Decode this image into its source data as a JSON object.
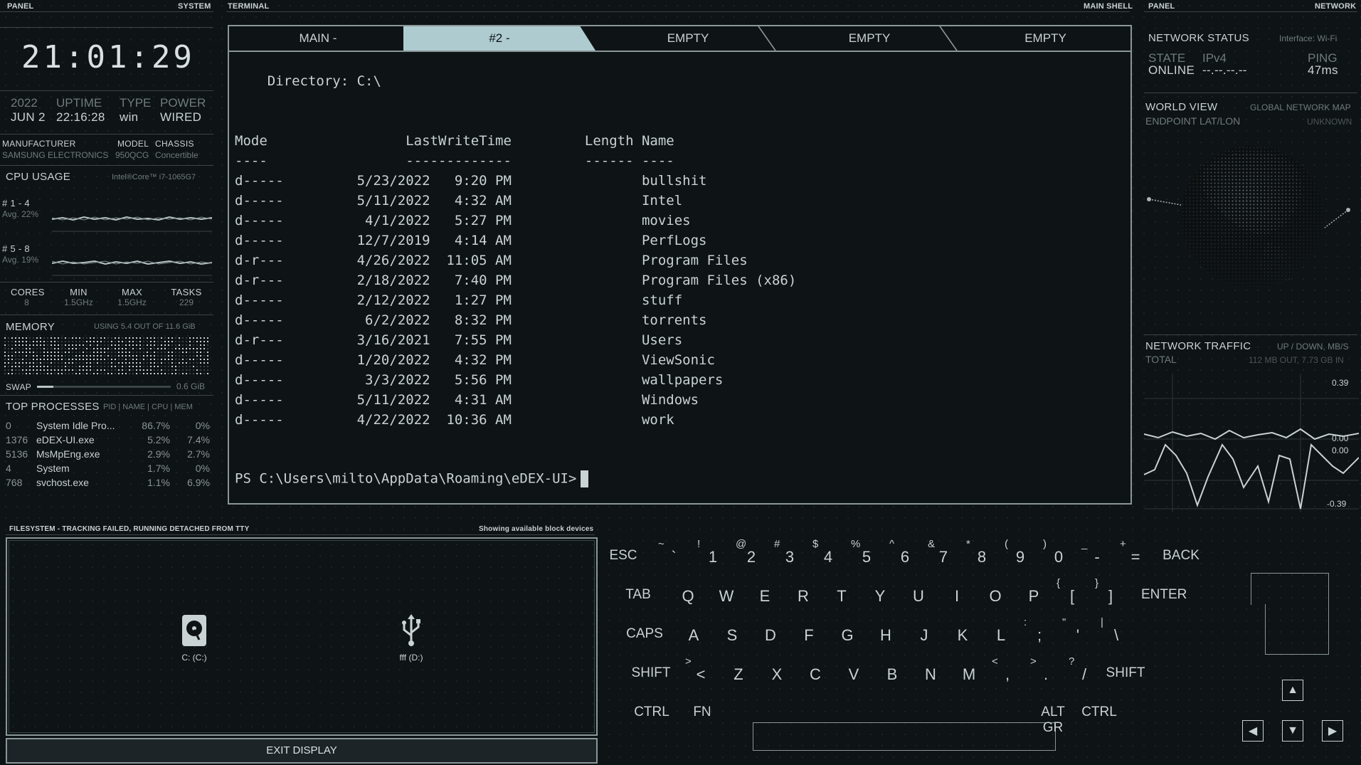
{
  "left_panel": {
    "header": {
      "left": "PANEL",
      "right": "SYSTEM"
    },
    "clock": "21:01:29",
    "sysinfo": [
      {
        "label": "2022",
        "value": "JUN 2"
      },
      {
        "label": "UPTIME",
        "value": "22:16:28"
      },
      {
        "label": "TYPE",
        "value": "win"
      },
      {
        "label": "POWER",
        "value": "WIRED"
      }
    ],
    "hw": {
      "manufacturer_label": "MANUFACTURER",
      "manufacturer": "SAMSUNG ELECTRONICS",
      "model_label": "MODEL",
      "model": "950QCG",
      "chassis_label": "CHASSIS",
      "chassis": "Concertible"
    },
    "cpu": {
      "title": "CPU USAGE",
      "model": "Intel®Core™ i7-1065G7",
      "group1": "# 1 - 4",
      "group1_avg": "Avg. 22%",
      "group2": "# 5 - 8",
      "group2_avg": "Avg. 19%",
      "stats": [
        {
          "label": "CORES",
          "value": "8"
        },
        {
          "label": "MIN",
          "value": "1.5GHz"
        },
        {
          "label": "MAX",
          "value": "1.5GHz"
        },
        {
          "label": "TASKS",
          "value": "229"
        }
      ]
    },
    "memory": {
      "title": "MEMORY",
      "usage": "USING 5.4 OUT OF 11.6 GiB",
      "swap_label": "SWAP",
      "swap_value": "0.6 GiB",
      "swap_fraction": 0.12
    },
    "processes": {
      "title": "TOP PROCESSES",
      "columns": "PID | NAME | CPU | MEM",
      "rows": [
        {
          "pid": "0",
          "name": "System Idle Pro...",
          "cpu": "86.7%",
          "mem": "0%"
        },
        {
          "pid": "1376",
          "name": "eDEX-UI.exe",
          "cpu": "5.2%",
          "mem": "7.4%"
        },
        {
          "pid": "5136",
          "name": "MsMpEng.exe",
          "cpu": "2.9%",
          "mem": "2.7%"
        },
        {
          "pid": "4",
          "name": "System",
          "cpu": "1.7%",
          "mem": "0%"
        },
        {
          "pid": "768",
          "name": "svchost.exe",
          "cpu": "1.1%",
          "mem": "6.9%"
        }
      ]
    }
  },
  "terminal": {
    "header": {
      "left": "TERMINAL",
      "right": "MAIN SHELL"
    },
    "tabs": [
      "MAIN -",
      "#2 -",
      "EMPTY",
      "EMPTY",
      "EMPTY"
    ],
    "directory_line": "    Directory: C:\\",
    "col_header": "Mode                 LastWriteTime         Length Name",
    "col_rule": "----                 -------------         ------ ----",
    "rows": [
      "d-----         5/23/2022   9:20 PM                bullshit",
      "d-----         5/11/2022   4:32 AM                Intel",
      "d-----          4/1/2022   5:27 PM                movies",
      "d-----         12/7/2019   4:14 AM                PerfLogs",
      "d-r---         4/26/2022  11:05 AM                Program Files",
      "d-r---         2/18/2022   7:40 PM                Program Files (x86)",
      "d-----         2/12/2022   1:27 PM                stuff",
      "d-----          6/2/2022   8:32 PM                torrents",
      "d-r---         3/16/2021   7:55 PM                Users",
      "d-----         1/20/2022   4:32 PM                ViewSonic",
      "d-----          3/3/2022   5:56 PM                wallpapers",
      "d-----         5/11/2022   4:31 AM                Windows",
      "d-----         4/22/2022  10:36 AM                work"
    ],
    "prompt": "PS C:\\Users\\milto\\AppData\\Roaming\\eDEX-UI>"
  },
  "right_panel": {
    "header": {
      "left": "PANEL",
      "right": "NETWORK"
    },
    "status": {
      "title": "NETWORK STATUS",
      "interface": "Interface: Wi-Fi",
      "state_label": "STATE",
      "state": "ONLINE",
      "ip_label": "IPv4",
      "ip": "--.--.--.--",
      "ping_label": "PING",
      "ping": "47ms"
    },
    "world": {
      "title": "WORLD VIEW",
      "subtitle": "GLOBAL NETWORK MAP",
      "endpoint_label": "ENDPOINT LAT/LON",
      "endpoint": "UNKNOWN"
    },
    "traffic": {
      "title": "NETWORK TRAFFIC",
      "units": "UP / DOWN, MB/S",
      "total_label": "TOTAL",
      "total": "112 MB OUT, 7.73 GB IN",
      "scale_top": "0.39",
      "scale_mid1": "0.00",
      "scale_mid2": "0.00",
      "scale_bot": "-0.39"
    }
  },
  "filesystem": {
    "title": "FILESYSTEM - TRACKING FAILED, RUNNING DETACHED FROM TTY",
    "subtitle": "Showing available block devices",
    "devices": [
      {
        "label": "C: (C:)",
        "icon": "hard-drive-icon"
      },
      {
        "label": "fff (D:)",
        "icon": "usb-icon"
      }
    ],
    "exit_label": "EXIT DISPLAY"
  },
  "keyboard": {
    "row1": [
      {
        "k": "ESC"
      },
      {
        "k": "`",
        "s": "~"
      },
      {
        "k": "1",
        "s": "!"
      },
      {
        "k": "2",
        "s": "@"
      },
      {
        "k": "3",
        "s": "#"
      },
      {
        "k": "4",
        "s": "$"
      },
      {
        "k": "5",
        "s": "%"
      },
      {
        "k": "6",
        "s": "^"
      },
      {
        "k": "7",
        "s": "&"
      },
      {
        "k": "8",
        "s": "*"
      },
      {
        "k": "9",
        "s": "("
      },
      {
        "k": "0",
        "s": ")"
      },
      {
        "k": "-",
        "s": "_"
      },
      {
        "k": "=",
        "s": "+"
      },
      {
        "k": "BACK"
      }
    ],
    "row2": [
      {
        "k": "TAB"
      },
      {
        "k": "Q"
      },
      {
        "k": "W"
      },
      {
        "k": "E"
      },
      {
        "k": "R"
      },
      {
        "k": "T"
      },
      {
        "k": "Y"
      },
      {
        "k": "U"
      },
      {
        "k": "I"
      },
      {
        "k": "O"
      },
      {
        "k": "P"
      },
      {
        "k": "[",
        "s": "{"
      },
      {
        "k": "]",
        "s": "}"
      },
      {
        "k": "ENTER"
      }
    ],
    "row3": [
      {
        "k": "CAPS"
      },
      {
        "k": "A"
      },
      {
        "k": "S"
      },
      {
        "k": "D"
      },
      {
        "k": "F"
      },
      {
        "k": "G"
      },
      {
        "k": "H"
      },
      {
        "k": "J"
      },
      {
        "k": "K"
      },
      {
        "k": "L"
      },
      {
        "k": ";",
        "s": ":"
      },
      {
        "k": "'",
        "s": "\""
      },
      {
        "k": "\\",
        "s": "|"
      }
    ],
    "row4": [
      {
        "k": "SHIFT"
      },
      {
        "k": "<",
        "s": ">"
      },
      {
        "k": "Z"
      },
      {
        "k": "X"
      },
      {
        "k": "C"
      },
      {
        "k": "V"
      },
      {
        "k": "B"
      },
      {
        "k": "N"
      },
      {
        "k": "M"
      },
      {
        "k": ",",
        "s": "<"
      },
      {
        "k": ".",
        "s": ">"
      },
      {
        "k": "/",
        "s": "?"
      },
      {
        "k": "SHIFT"
      }
    ],
    "row5": [
      {
        "k": "CTRL"
      },
      {
        "k": "FN"
      },
      {
        "k": "ALT GR"
      },
      {
        "k": "CTRL"
      }
    ],
    "arrows": {
      "up": "▲",
      "left": "◀",
      "down": "▼",
      "right": "▶"
    }
  }
}
